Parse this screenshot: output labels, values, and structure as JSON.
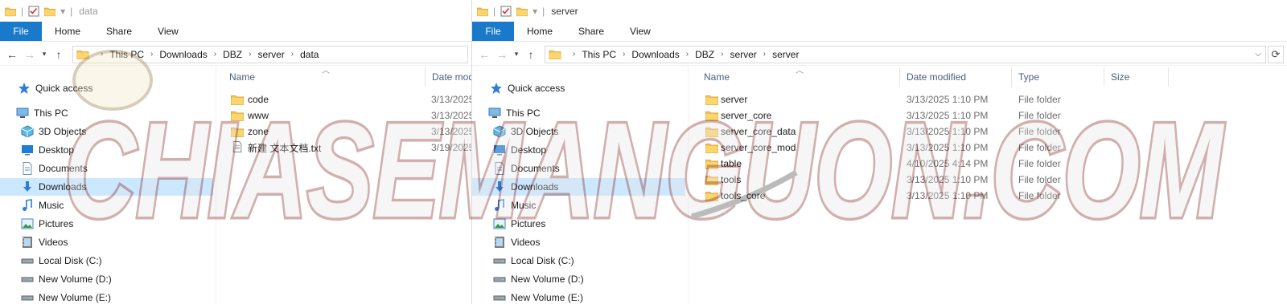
{
  "left_window": {
    "title": "data",
    "tabs": [
      "File",
      "Home",
      "Share",
      "View"
    ],
    "breadcrumb": [
      "This PC",
      "Downloads",
      "DBZ",
      "server",
      "data"
    ],
    "nav": [
      {
        "label": "Quick access",
        "icon": "star-icon"
      },
      {
        "label": "This PC",
        "icon": "computer-icon"
      },
      {
        "label": "3D Objects",
        "icon": "cube-icon"
      },
      {
        "label": "Desktop",
        "icon": "desktop-icon"
      },
      {
        "label": "Documents",
        "icon": "document-icon"
      },
      {
        "label": "Downloads",
        "icon": "download-icon"
      },
      {
        "label": "Music",
        "icon": "music-icon"
      },
      {
        "label": "Pictures",
        "icon": "picture-icon"
      },
      {
        "label": "Videos",
        "icon": "video-icon"
      },
      {
        "label": "Local Disk (C:)",
        "icon": "drive-icon"
      },
      {
        "label": "New Volume (D:)",
        "icon": "drive-icon"
      },
      {
        "label": "New Volume (E:)",
        "icon": "drive-icon"
      }
    ],
    "columns": {
      "name": "Name",
      "date": "Date mod"
    },
    "files": [
      {
        "name": "code",
        "date": "3/13/2025",
        "kind": "folder"
      },
      {
        "name": "www",
        "date": "3/13/2025",
        "kind": "folder"
      },
      {
        "name": "zone",
        "date": "3/13/2025",
        "kind": "folder"
      },
      {
        "name": "新建 文本文档.txt",
        "date": "3/19/2025",
        "kind": "text"
      }
    ]
  },
  "right_window": {
    "title": "server",
    "tabs": [
      "File",
      "Home",
      "Share",
      "View"
    ],
    "breadcrumb": [
      "This PC",
      "Downloads",
      "DBZ",
      "server",
      "server"
    ],
    "nav": [
      {
        "label": "Quick access",
        "icon": "star-icon"
      },
      {
        "label": "This PC",
        "icon": "computer-icon"
      },
      {
        "label": "3D Objects",
        "icon": "cube-icon"
      },
      {
        "label": "Desktop",
        "icon": "desktop-icon"
      },
      {
        "label": "Documents",
        "icon": "document-icon"
      },
      {
        "label": "Downloads",
        "icon": "download-icon"
      },
      {
        "label": "Music",
        "icon": "music-icon"
      },
      {
        "label": "Pictures",
        "icon": "picture-icon"
      },
      {
        "label": "Videos",
        "icon": "video-icon"
      },
      {
        "label": "Local Disk (C:)",
        "icon": "drive-icon"
      },
      {
        "label": "New Volume (D:)",
        "icon": "drive-icon"
      },
      {
        "label": "New Volume (E:)",
        "icon": "drive-icon"
      }
    ],
    "columns": {
      "name": "Name",
      "date": "Date modified",
      "type": "Type",
      "size": "Size"
    },
    "files": [
      {
        "name": "server",
        "date": "3/13/2025 1:10 PM",
        "type": "File folder"
      },
      {
        "name": "server_core",
        "date": "3/13/2025 1:10 PM",
        "type": "File folder"
      },
      {
        "name": "server_core_data",
        "date": "3/13/2025 1:10 PM",
        "type": "File folder"
      },
      {
        "name": "server_core_mod",
        "date": "3/13/2025 1:10 PM",
        "type": "File folder"
      },
      {
        "name": "table",
        "date": "4/10/2025 4:14 PM",
        "type": "File folder"
      },
      {
        "name": "tools",
        "date": "3/13/2025 1:10 PM",
        "type": "File folder"
      },
      {
        "name": "tools_core",
        "date": "3/13/2025 1:10 PM",
        "type": "File folder"
      }
    ]
  },
  "watermark": {
    "text": "CHIASEMANGUON.COM"
  },
  "colors": {
    "accent": "#1979ca",
    "selected": "#cce8ff",
    "folder": "#f4c55a"
  }
}
